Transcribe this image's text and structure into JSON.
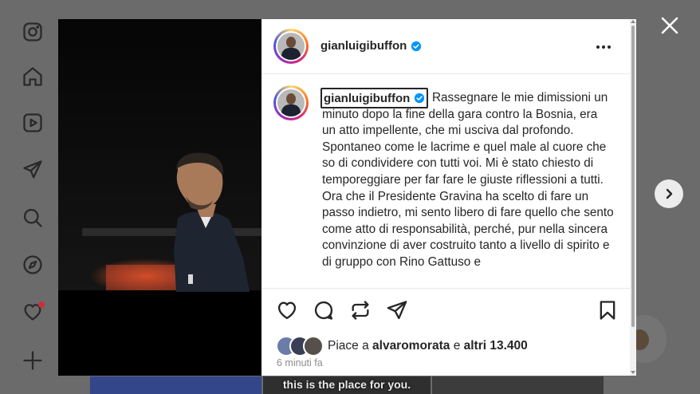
{
  "rail": {
    "items": [
      {
        "name": "instagram-logo-icon"
      },
      {
        "name": "home-icon"
      },
      {
        "name": "reels-icon"
      },
      {
        "name": "direct-icon"
      },
      {
        "name": "search-icon"
      },
      {
        "name": "explore-icon"
      },
      {
        "name": "notifications-icon"
      },
      {
        "name": "create-icon"
      }
    ]
  },
  "background": {
    "caption": "this is the place for you."
  },
  "post": {
    "username": "gianluigibuffon",
    "verified": true,
    "more_label": "•••",
    "caption_username": "gianluigibuffon",
    "caption": "Rassegnare le mie dimissioni un minuto dopo la fine della gara contro la Bosnia, era un atto impellente, che mi usciva dal profondo. Spontaneo come le lacrime e quel male al cuore che so di condividere con tutti voi. Mi è stato chiesto di temporeggiare per far fare le giuste riflessioni a tutti.",
    "caption_2": "Ora che il Presidente Gravina ha scelto di fare un passo indietro, mi sento libero di fare quello che sento come atto di responsabilità, perché, pur nella sincera convinzione di aver costruito tanto a livello di spirito e di gruppo con Rino Gattuso e",
    "likes_prefix": "Piace a",
    "likes_user": "alvaromorata",
    "likes_and": "e",
    "likes_others": "altri 13.400",
    "time": "6 minuti fa"
  },
  "colors": {
    "verified": "#0095f6",
    "text": "#262626",
    "muted": "#8e8e8e",
    "overlay": "#6b6b6b"
  }
}
